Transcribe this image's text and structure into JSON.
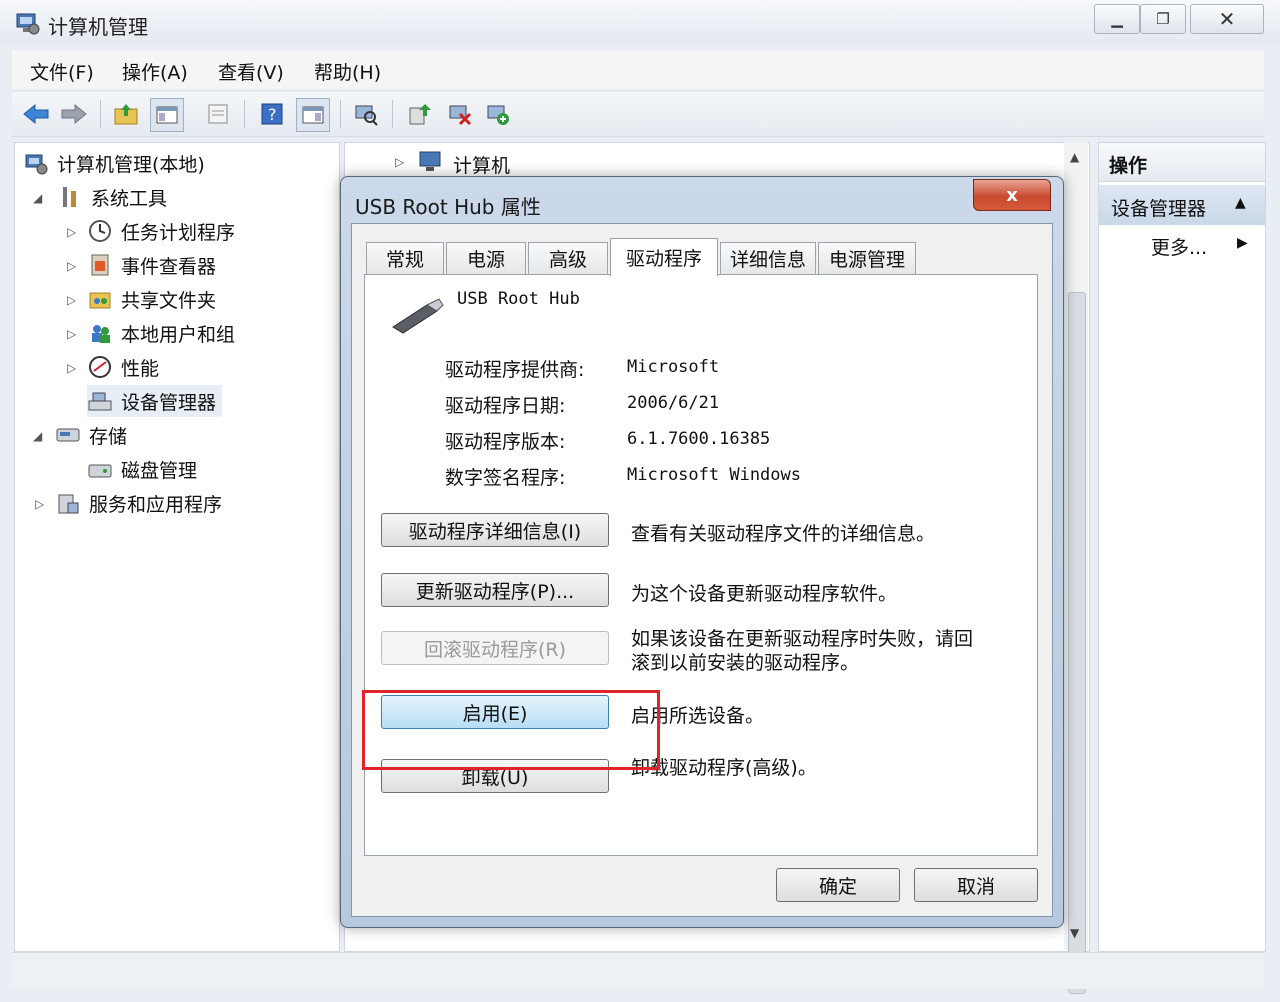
{
  "window": {
    "title": "计算机管理"
  },
  "menu": [
    "文件(F)",
    "操作(A)",
    "查看(V)",
    "帮助(H)"
  ],
  "tree": {
    "root": "计算机管理(本地)",
    "system_tools": "系统工具",
    "task_scheduler": "任务计划程序",
    "event_viewer": "事件查看器",
    "shared_folders": "共享文件夹",
    "local_users": "本地用户和组",
    "performance": "性能",
    "device_manager": "设备管理器",
    "storage": "存储",
    "disk_management": "磁盘管理",
    "services_apps": "服务和应用程序"
  },
  "device_tree": {
    "computer": "计算机"
  },
  "actions": {
    "header": "操作",
    "group": "设备管理器",
    "more": "更多..."
  },
  "dialog": {
    "title": "USB Root Hub 属性",
    "close": "x",
    "tabs": [
      "常规",
      "电源",
      "高级",
      "驱动程序",
      "详细信息",
      "电源管理"
    ],
    "device_name": "USB Root Hub",
    "fields": [
      {
        "label": "驱动程序提供商:",
        "value": "Microsoft"
      },
      {
        "label": "驱动程序日期:",
        "value": "2006/6/21"
      },
      {
        "label": "驱动程序版本:",
        "value": "6.1.7600.16385"
      },
      {
        "label": "数字签名程序:",
        "value": "Microsoft Windows"
      }
    ],
    "buttons": [
      {
        "label": "驱动程序详细信息(I)",
        "desc": "查看有关驱动程序文件的详细信息。"
      },
      {
        "label": "更新驱动程序(P)...",
        "desc": "为这个设备更新驱动程序软件。"
      },
      {
        "label": "回滚驱动程序(R)",
        "desc": "如果该设备在更新驱动程序时失败，请回滚到以前安装的驱动程序。"
      },
      {
        "label": "启用(E)",
        "desc": "启用所选设备。"
      },
      {
        "label": "卸载(U)",
        "desc": "卸载驱动程序(高级)。"
      }
    ],
    "ok": "确定",
    "cancel": "取消"
  },
  "colors": {
    "highlight": "#e0242b",
    "focus": "#3c7fb1"
  }
}
